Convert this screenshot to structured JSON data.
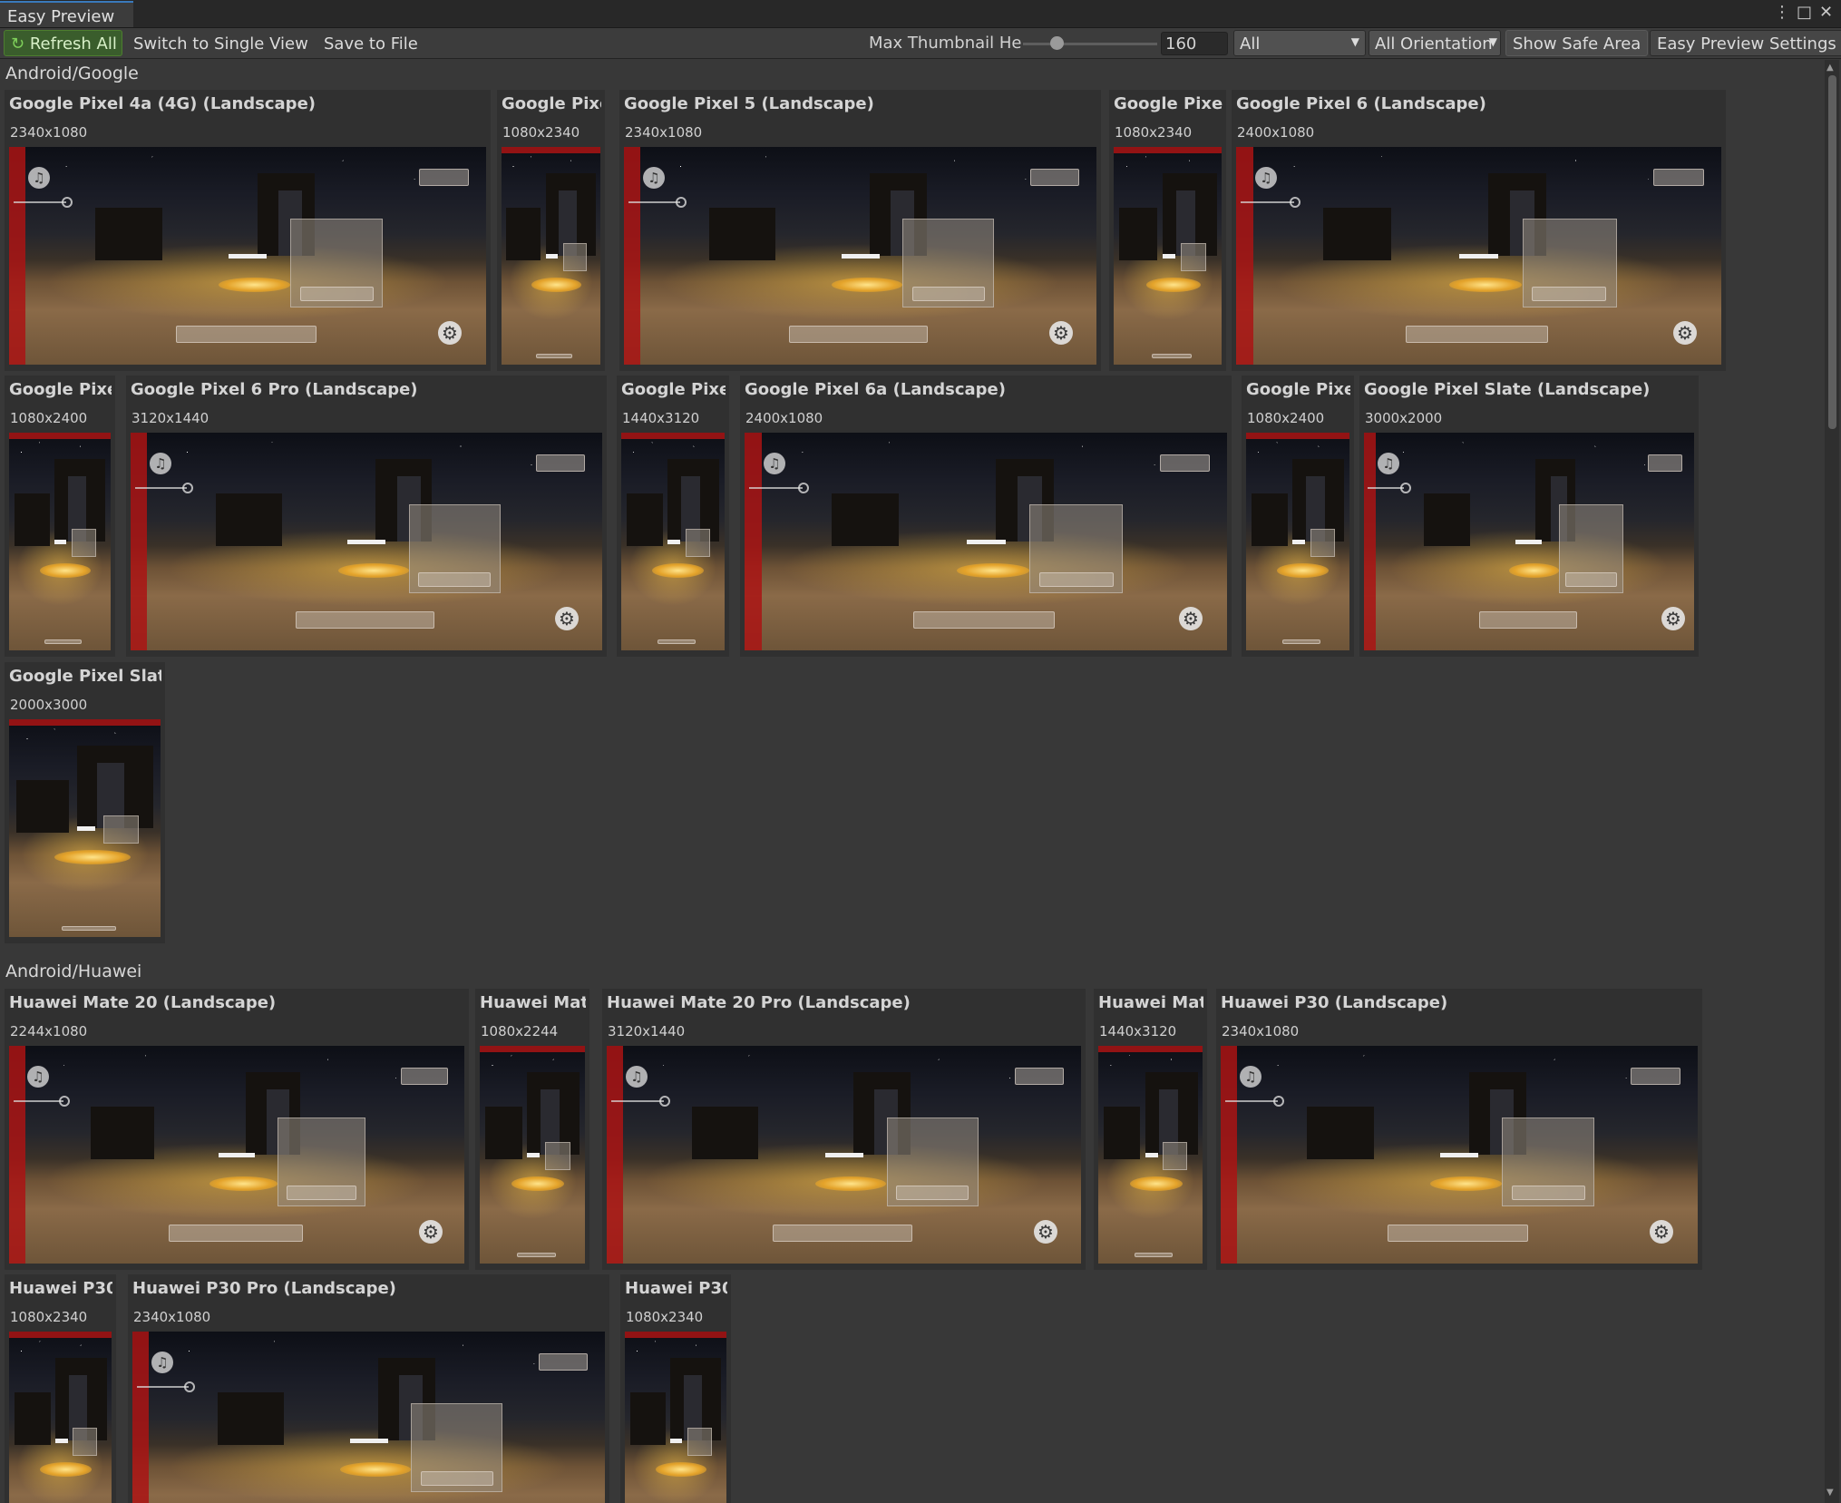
{
  "window": {
    "tab_title": "Easy Preview"
  },
  "toolbar": {
    "refresh_all": "Refresh All",
    "switch_view": "Switch to Single View",
    "save_to_file": "Save to File",
    "max_thumb_label": "Max Thumbnail He",
    "max_thumb_value": "160",
    "max_thumb_fraction": 0.2,
    "filter_all": "All",
    "orientation": "All Orientation",
    "show_safe_area": "Show Safe Area",
    "settings": "Easy Preview Settings"
  },
  "groups": [
    {
      "name": "Android/Google",
      "devices": [
        {
          "title": "Google Pixel 4a (4G) (Landscape)",
          "res": "2340x1080",
          "orientation": "landscape"
        },
        {
          "title": "Google Pixe",
          "res": "1080x2340",
          "orientation": "portrait"
        },
        {
          "title": "Google Pixel 5 (Landscape)",
          "res": "2340x1080",
          "orientation": "landscape"
        },
        {
          "title": "Google Pixe",
          "res": "1080x2340",
          "orientation": "portrait"
        },
        {
          "title": "Google Pixel 6 (Landscape)",
          "res": "2400x1080",
          "orientation": "landscape"
        },
        {
          "title": "Google Pixe",
          "res": "1080x2400",
          "orientation": "portrait"
        },
        {
          "title": "Google Pixel 6 Pro (Landscape)",
          "res": "3120x1440",
          "orientation": "landscape"
        },
        {
          "title": "Google Pixe",
          "res": "1440x3120",
          "orientation": "portrait"
        },
        {
          "title": "Google Pixel 6a (Landscape)",
          "res": "2400x1080",
          "orientation": "landscape"
        },
        {
          "title": "Google Pixe",
          "res": "1080x2400",
          "orientation": "portrait"
        },
        {
          "title": "Google Pixel Slate (Landscape)",
          "res": "3000x2000",
          "orientation": "landscape"
        },
        {
          "title": "Google Pixel Slat",
          "res": "2000x3000",
          "orientation": "portrait"
        }
      ]
    },
    {
      "name": "Android/Huawei",
      "devices": [
        {
          "title": "Huawei Mate 20 (Landscape)",
          "res": "2244x1080",
          "orientation": "landscape"
        },
        {
          "title": "Huawei Mat",
          "res": "1080x2244",
          "orientation": "portrait"
        },
        {
          "title": "Huawei Mate 20 Pro (Landscape)",
          "res": "3120x1440",
          "orientation": "landscape"
        },
        {
          "title": "Huawei Mat",
          "res": "1440x3120",
          "orientation": "portrait"
        },
        {
          "title": "Huawei P30 (Landscape)",
          "res": "2340x1080",
          "orientation": "landscape"
        },
        {
          "title": "Huawei P30",
          "res": "1080x2340",
          "orientation": "portrait"
        },
        {
          "title": "Huawei P30 Pro (Landscape)",
          "res": "2340x1080",
          "orientation": "landscape"
        },
        {
          "title": "Huawei P30",
          "res": "1080x2340",
          "orientation": "portrait"
        }
      ]
    }
  ],
  "colors": {
    "safe_area": "#aa1414",
    "refresh_accent": "#3a5d2c",
    "tab_accent": "#3a79bb"
  },
  "icons": {
    "refresh": "refresh-icon",
    "menu": "kebab-menu-icon",
    "maximize": "maximize-icon",
    "close": "close-icon",
    "music": "music-note-icon",
    "gear": "gear-icon"
  }
}
